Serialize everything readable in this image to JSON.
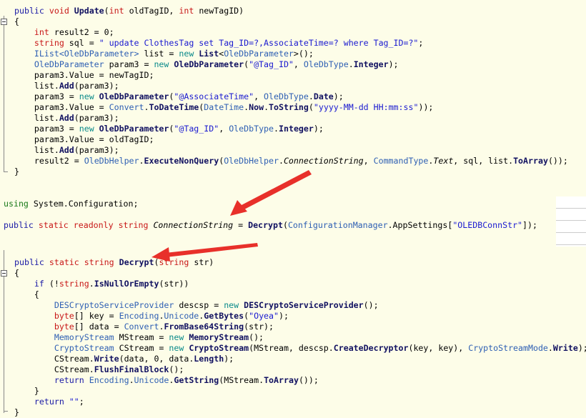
{
  "colors": {
    "background": "#fdfde8",
    "keyword": "#1a1aa6",
    "type_keyword": "#c81818",
    "class": "#2e5fb3",
    "new": "#0a8a8a",
    "string": "#1a1ad0",
    "arrow": "#e8302a"
  },
  "blocks": [
    {
      "name": "update-method",
      "lines": [
        [
          [
            "public ",
            "k"
          ],
          [
            "void ",
            "r"
          ],
          [
            "Update",
            "m"
          ],
          [
            "(",
            "p"
          ],
          [
            "int ",
            "r"
          ],
          [
            "oldTagID, ",
            "p"
          ],
          [
            "int ",
            "r"
          ],
          [
            "newTagID)",
            "p"
          ]
        ],
        [
          [
            "{",
            "p"
          ]
        ],
        [
          [
            "    ",
            "p"
          ],
          [
            "int ",
            "r"
          ],
          [
            "result2 = 0;",
            "p"
          ]
        ],
        [
          [
            "    ",
            "p"
          ],
          [
            "string ",
            "r"
          ],
          [
            "sql = ",
            "p"
          ],
          [
            "\" update ClothesTag set Tag_ID=?,AssociateTime=? where Tag_ID=?\"",
            "s"
          ],
          [
            ";",
            "p"
          ]
        ],
        [
          [
            "    ",
            "p"
          ],
          [
            "IList<OleDbParameter> ",
            "t"
          ],
          [
            "list = ",
            "p"
          ],
          [
            "new ",
            "n"
          ],
          [
            "List",
            "m"
          ],
          [
            "<",
            "p"
          ],
          [
            "OleDbParameter",
            "t"
          ],
          [
            ">();",
            "p"
          ]
        ],
        [
          [
            "    ",
            "p"
          ],
          [
            "OleDbParameter ",
            "t"
          ],
          [
            "param3 = ",
            "p"
          ],
          [
            "new ",
            "n"
          ],
          [
            "OleDbParameter",
            "m"
          ],
          [
            "(",
            "p"
          ],
          [
            "\"@Tag_ID\"",
            "s"
          ],
          [
            ", ",
            "p"
          ],
          [
            "OleDbType",
            "t"
          ],
          [
            ".",
            "p"
          ],
          [
            "Integer",
            "m"
          ],
          [
            ");",
            "p"
          ]
        ],
        [
          [
            "    ",
            "p"
          ],
          [
            "param3.Value = newTagID;",
            "p"
          ]
        ],
        [
          [
            "    ",
            "p"
          ],
          [
            "list.",
            "p"
          ],
          [
            "Add",
            "m"
          ],
          [
            "(param3);",
            "p"
          ]
        ],
        [
          [
            "    ",
            "p"
          ],
          [
            "param3 = ",
            "p"
          ],
          [
            "new ",
            "n"
          ],
          [
            "OleDbParameter",
            "m"
          ],
          [
            "(",
            "p"
          ],
          [
            "\"@AssociateTime\"",
            "s"
          ],
          [
            ", ",
            "p"
          ],
          [
            "OleDbType",
            "t"
          ],
          [
            ".",
            "p"
          ],
          [
            "Date",
            "m"
          ],
          [
            ");",
            "p"
          ]
        ],
        [
          [
            "    ",
            "p"
          ],
          [
            "param3.Value = ",
            "p"
          ],
          [
            "Convert",
            "t"
          ],
          [
            ".",
            "p"
          ],
          [
            "ToDateTime",
            "m"
          ],
          [
            "(",
            "p"
          ],
          [
            "DateTime",
            "t"
          ],
          [
            ".",
            "p"
          ],
          [
            "Now",
            "m"
          ],
          [
            ".",
            "p"
          ],
          [
            "ToString",
            "m"
          ],
          [
            "(",
            "p"
          ],
          [
            "\"yyyy-MM-dd HH:mm:ss\"",
            "s"
          ],
          [
            "));",
            "p"
          ]
        ],
        [
          [
            "    ",
            "p"
          ],
          [
            "list.",
            "p"
          ],
          [
            "Add",
            "m"
          ],
          [
            "(param3);",
            "p"
          ]
        ],
        [
          [
            "    ",
            "p"
          ],
          [
            "param3 = ",
            "p"
          ],
          [
            "new ",
            "n"
          ],
          [
            "OleDbParameter",
            "m"
          ],
          [
            "(",
            "p"
          ],
          [
            "\"@Tag_ID\"",
            "s"
          ],
          [
            ", ",
            "p"
          ],
          [
            "OleDbType",
            "t"
          ],
          [
            ".",
            "p"
          ],
          [
            "Integer",
            "m"
          ],
          [
            ");",
            "p"
          ]
        ],
        [
          [
            "    ",
            "p"
          ],
          [
            "param3.Value = oldTagID;",
            "p"
          ]
        ],
        [
          [
            "    ",
            "p"
          ],
          [
            "list.",
            "p"
          ],
          [
            "Add",
            "m"
          ],
          [
            "(param3);",
            "p"
          ]
        ],
        [
          [
            "    ",
            "p"
          ],
          [
            "result2 = ",
            "p"
          ],
          [
            "OleDbHelper",
            "t"
          ],
          [
            ".",
            "p"
          ],
          [
            "ExecuteNonQuery",
            "m"
          ],
          [
            "(",
            "p"
          ],
          [
            "OleDbHelper",
            "t"
          ],
          [
            ".",
            "p"
          ],
          [
            "ConnectionString",
            "i"
          ],
          [
            ", ",
            "p"
          ],
          [
            "CommandType",
            "t"
          ],
          [
            ".",
            "p"
          ],
          [
            "Text",
            "i"
          ],
          [
            ", sql, list.",
            "p"
          ],
          [
            "ToArray",
            "m"
          ],
          [
            "());",
            "p"
          ]
        ],
        [
          [
            "}",
            "p"
          ]
        ]
      ]
    },
    {
      "name": "connection-string",
      "lines": [
        [
          [
            "using ",
            "g"
          ],
          [
            "System.Configuration;",
            "p"
          ]
        ],
        [
          [
            "",
            "p"
          ]
        ],
        [
          [
            "public ",
            "k"
          ],
          [
            "static ",
            "r"
          ],
          [
            "readonly ",
            "r"
          ],
          [
            "string ",
            "r"
          ],
          [
            "ConnectionString",
            "i"
          ],
          [
            " = ",
            "p"
          ],
          [
            "Decrypt",
            "m"
          ],
          [
            "(",
            "p"
          ],
          [
            "ConfigurationManager",
            "t"
          ],
          [
            ".AppSettings[",
            "p"
          ],
          [
            "\"OLEDBConnStr\"",
            "s"
          ],
          [
            "]);",
            "p"
          ]
        ]
      ]
    },
    {
      "name": "decrypt-method",
      "lines": [
        [
          [
            "public ",
            "k"
          ],
          [
            "static ",
            "r"
          ],
          [
            "string ",
            "r"
          ],
          [
            "Decrypt",
            "m"
          ],
          [
            "(",
            "p"
          ],
          [
            "string ",
            "r"
          ],
          [
            "str)",
            "p"
          ]
        ],
        [
          [
            "{",
            "p"
          ]
        ],
        [
          [
            "    ",
            "p"
          ],
          [
            "if ",
            "k"
          ],
          [
            "(!",
            "p"
          ],
          [
            "string",
            "r"
          ],
          [
            ".",
            "p"
          ],
          [
            "IsNullOrEmpty",
            "m"
          ],
          [
            "(str))",
            "p"
          ]
        ],
        [
          [
            "    ",
            "p"
          ],
          [
            "{",
            "p"
          ]
        ],
        [
          [
            "        ",
            "p"
          ],
          [
            "DESCryptoServiceProvider ",
            "t"
          ],
          [
            "descsp = ",
            "p"
          ],
          [
            "new ",
            "n"
          ],
          [
            "DESCryptoServiceProvider",
            "m"
          ],
          [
            "();",
            "p"
          ]
        ],
        [
          [
            "        ",
            "p"
          ],
          [
            "byte",
            "r"
          ],
          [
            "[] key = ",
            "p"
          ],
          [
            "Encoding",
            "t"
          ],
          [
            ".",
            "p"
          ],
          [
            "Unicode",
            "t"
          ],
          [
            ".",
            "p"
          ],
          [
            "GetBytes",
            "m"
          ],
          [
            "(",
            "p"
          ],
          [
            "\"Oyea\"",
            "s"
          ],
          [
            ");",
            "p"
          ]
        ],
        [
          [
            "        ",
            "p"
          ],
          [
            "byte",
            "r"
          ],
          [
            "[] data = ",
            "p"
          ],
          [
            "Convert",
            "t"
          ],
          [
            ".",
            "p"
          ],
          [
            "FromBase64String",
            "m"
          ],
          [
            "(str);",
            "p"
          ]
        ],
        [
          [
            "        ",
            "p"
          ],
          [
            "MemoryStream ",
            "t"
          ],
          [
            "MStream = ",
            "p"
          ],
          [
            "new ",
            "n"
          ],
          [
            "MemoryStream",
            "m"
          ],
          [
            "();",
            "p"
          ]
        ],
        [
          [
            "        ",
            "p"
          ],
          [
            "CryptoStream ",
            "t"
          ],
          [
            "CStream = ",
            "p"
          ],
          [
            "new ",
            "n"
          ],
          [
            "CryptoStream",
            "m"
          ],
          [
            "(MStream, descsp.",
            "p"
          ],
          [
            "CreateDecryptor",
            "m"
          ],
          [
            "(key, key), ",
            "p"
          ],
          [
            "CryptoStreamMode",
            "t"
          ],
          [
            ".",
            "p"
          ],
          [
            "Write",
            "m"
          ],
          [
            ");",
            "p"
          ]
        ],
        [
          [
            "        ",
            "p"
          ],
          [
            "CStream.",
            "p"
          ],
          [
            "Write",
            "m"
          ],
          [
            "(data, 0, data.",
            "p"
          ],
          [
            "Length",
            "m"
          ],
          [
            ");",
            "p"
          ]
        ],
        [
          [
            "        ",
            "p"
          ],
          [
            "CStream.",
            "p"
          ],
          [
            "FlushFinalBlock",
            "m"
          ],
          [
            "();",
            "p"
          ]
        ],
        [
          [
            "        ",
            "p"
          ],
          [
            "return ",
            "k"
          ],
          [
            "Encoding",
            "t"
          ],
          [
            ".",
            "p"
          ],
          [
            "Unicode",
            "t"
          ],
          [
            ".",
            "p"
          ],
          [
            "GetString",
            "m"
          ],
          [
            "(MStream.",
            "p"
          ],
          [
            "ToArray",
            "m"
          ],
          [
            "());",
            "p"
          ]
        ],
        [
          [
            "    ",
            "p"
          ],
          [
            "}",
            "p"
          ]
        ],
        [
          [
            "    ",
            "p"
          ],
          [
            "return ",
            "k"
          ],
          [
            "\"\"",
            "s"
          ],
          [
            ";",
            "p"
          ]
        ],
        [
          [
            "}",
            "p"
          ]
        ]
      ]
    }
  ]
}
